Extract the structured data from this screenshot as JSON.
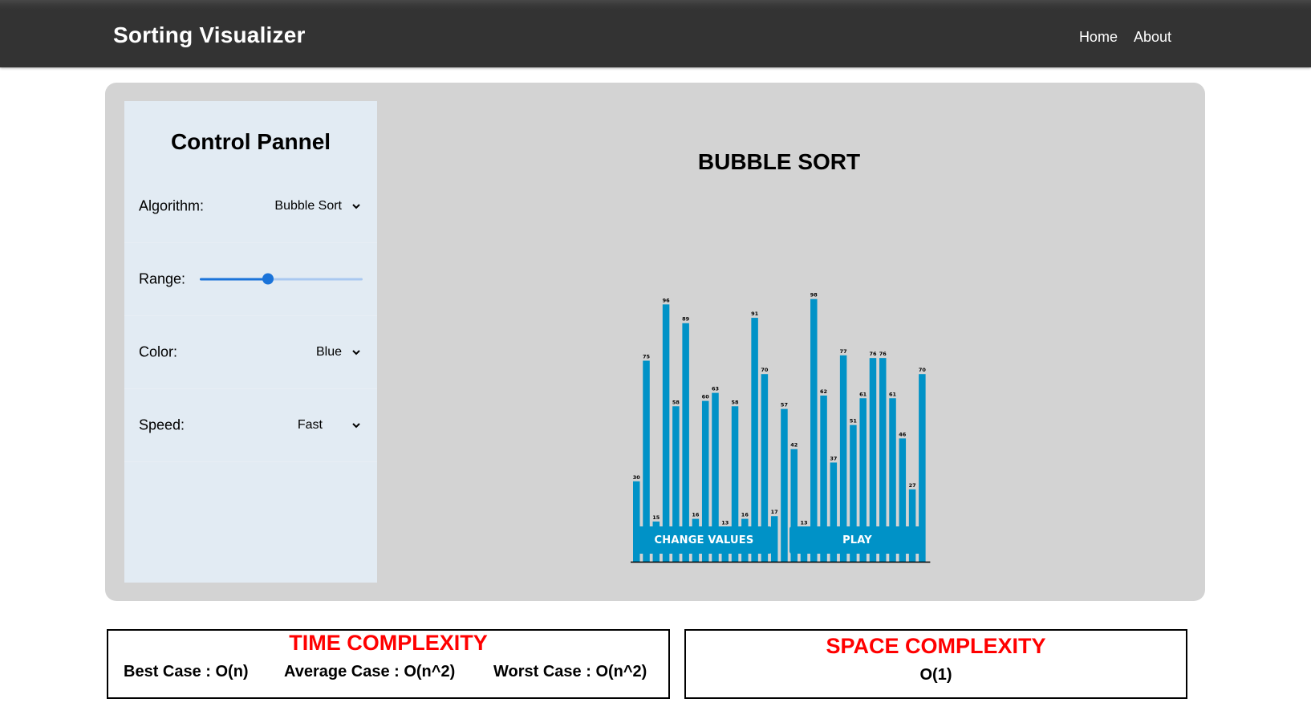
{
  "navbar": {
    "brand": "Sorting Visualizer",
    "links": [
      "Home",
      "About"
    ]
  },
  "control_panel": {
    "title": "Control Pannel",
    "algorithm": {
      "label": "Algorithm:",
      "value": "Bubble Sort"
    },
    "range": {
      "label": "Range:",
      "value_fraction": 0.42
    },
    "color": {
      "label": "Color:",
      "value": "Blue"
    },
    "speed": {
      "label": "Speed:",
      "value": "Fast"
    }
  },
  "visualizer": {
    "title": "BUBBLE SORT",
    "bar_color": "#0092c7",
    "buttons": {
      "change_values": "CHANGE VALUES",
      "play": "PLAY"
    }
  },
  "chart_data": {
    "type": "bar",
    "values": [
      30,
      75,
      15,
      96,
      58,
      89,
      16,
      60,
      63,
      13,
      58,
      16,
      91,
      70,
      17,
      57,
      42,
      13,
      98,
      62,
      37,
      77,
      51,
      61,
      76,
      76,
      61,
      46,
      27,
      70
    ],
    "data_labels": true,
    "ylim": [
      0,
      100
    ]
  },
  "time_complexity": {
    "title": "TIME COMPLEXITY",
    "best": "Best Case : O(n)",
    "average": "Average Case : O(n^2)",
    "worst": "Worst Case : O(n^2)"
  },
  "space_complexity": {
    "title": "SPACE COMPLEXITY",
    "value": "O(1)"
  },
  "colors": {
    "title_red": "#ff0000",
    "button_blue": "#0092c7",
    "panel_gray": "#d3d3d3",
    "control_bg": "#e2ebf3",
    "navbar_bg": "#333333"
  }
}
